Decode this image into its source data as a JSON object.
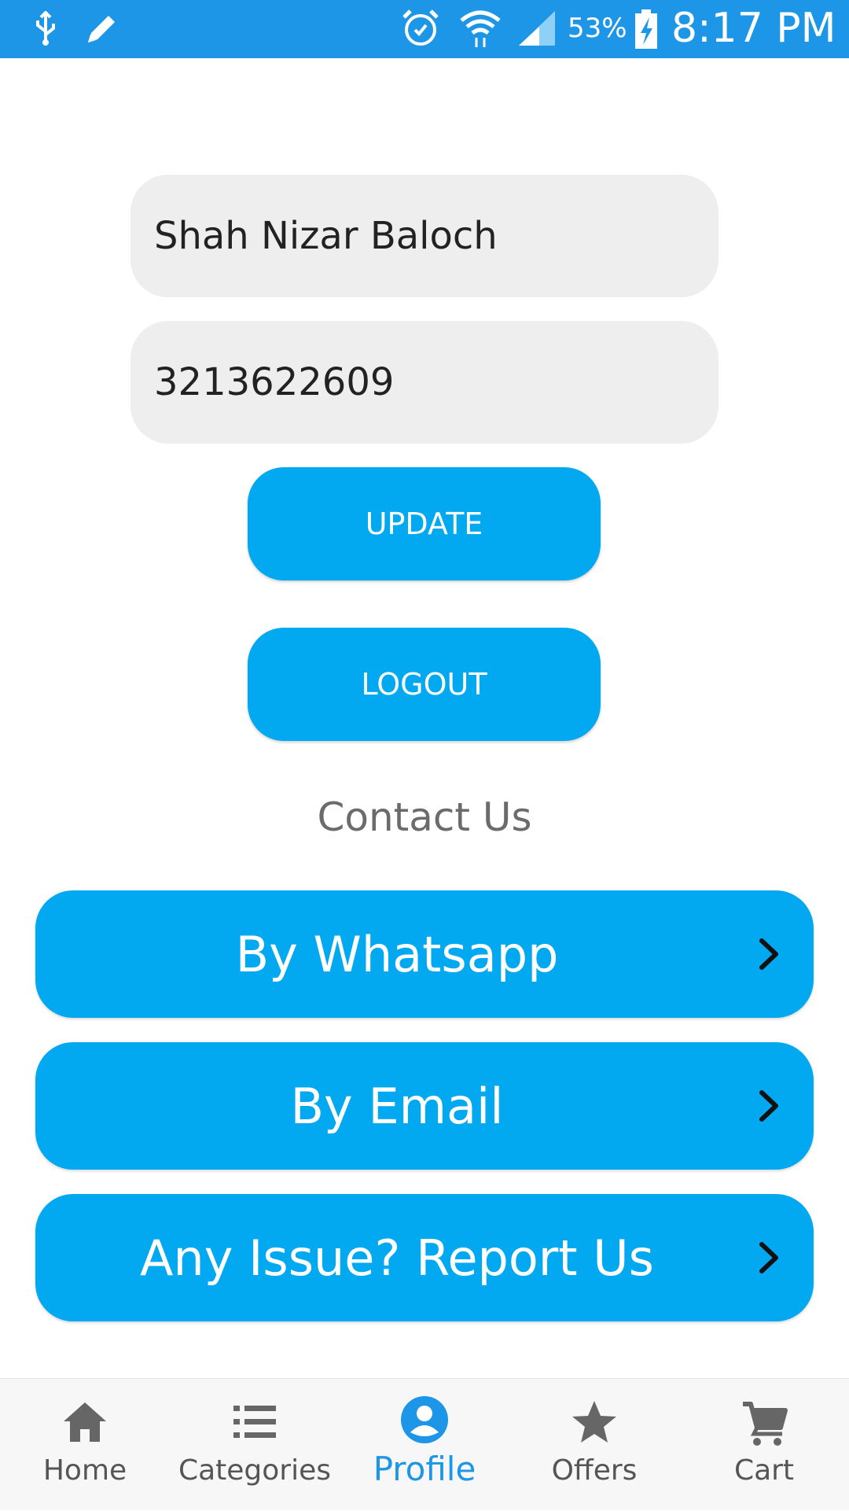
{
  "status_bar": {
    "battery_percent": "53%",
    "time": "8:17 PM",
    "icons": [
      "usb-icon",
      "edit-icon",
      "alarm-icon",
      "wifi-icon",
      "signal-icon",
      "battery-charging-icon"
    ]
  },
  "profile_form": {
    "name_value": "Shah Nizar Baloch",
    "phone_value": "3213622609",
    "update_label": "UPDATE",
    "logout_label": "LOGOUT"
  },
  "contact": {
    "title": "Contact Us",
    "items": [
      {
        "label": "By Whatsapp",
        "icon": "chevron-right-icon"
      },
      {
        "label": "By Email",
        "icon": "chevron-right-icon"
      },
      {
        "label": "Any Issue? Report Us",
        "icon": "chevron-right-icon"
      }
    ]
  },
  "bottom_nav": {
    "active": "Profile",
    "items": [
      {
        "label": "Home",
        "icon": "home-icon"
      },
      {
        "label": "Categories",
        "icon": "list-icon"
      },
      {
        "label": "Profile",
        "icon": "profile-icon"
      },
      {
        "label": "Offers",
        "icon": "star-icon"
      },
      {
        "label": "Cart",
        "icon": "cart-icon"
      }
    ]
  },
  "colors": {
    "primary": "#03a9f0",
    "status_bar": "#1e96e8",
    "active_nav": "#1e96e8",
    "field_bg": "#eeeeee"
  }
}
